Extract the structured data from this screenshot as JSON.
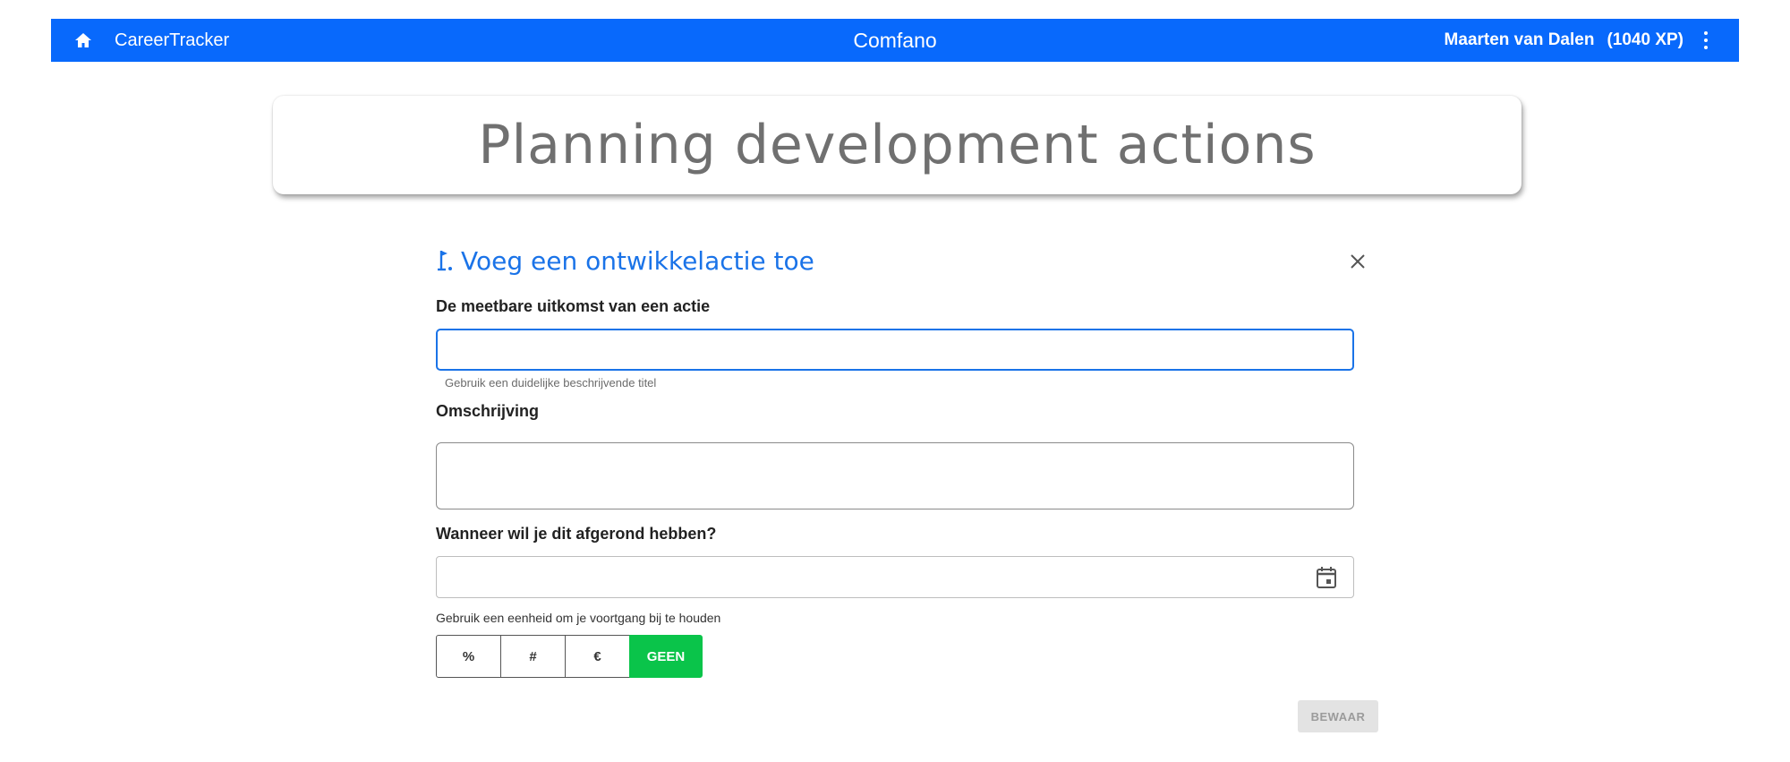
{
  "topbar": {
    "app_name": "CareerTracker",
    "company": "Comfano",
    "user_name": "Maarten van Dalen",
    "user_xp": "(1040 XP)",
    "icons": [
      "home-icon",
      "more-vert-icon"
    ],
    "background_color": "#0869fc"
  },
  "page": {
    "title": "Planning development actions"
  },
  "form": {
    "title": "Voeg een ontwikkelactie toe",
    "title_color": "#1a73e8",
    "outcome_label": "De meetbare uitkomst van een actie",
    "outcome_value": "",
    "outcome_hint": "Gebruik een duidelijke beschrijvende titel",
    "description_label": "Omschrijving",
    "description_value": "",
    "deadline_label": "Wanneer wil je dit afgerond hebben?",
    "deadline_value": "",
    "unit_hint": "Gebruik een eenheid om je voortgang bij te houden",
    "units": [
      "%",
      "#",
      "€",
      "GEEN"
    ],
    "selected_unit": "GEEN",
    "selected_unit_color": "#0ac44a",
    "save_label": "BEWAAR",
    "save_enabled": false
  }
}
